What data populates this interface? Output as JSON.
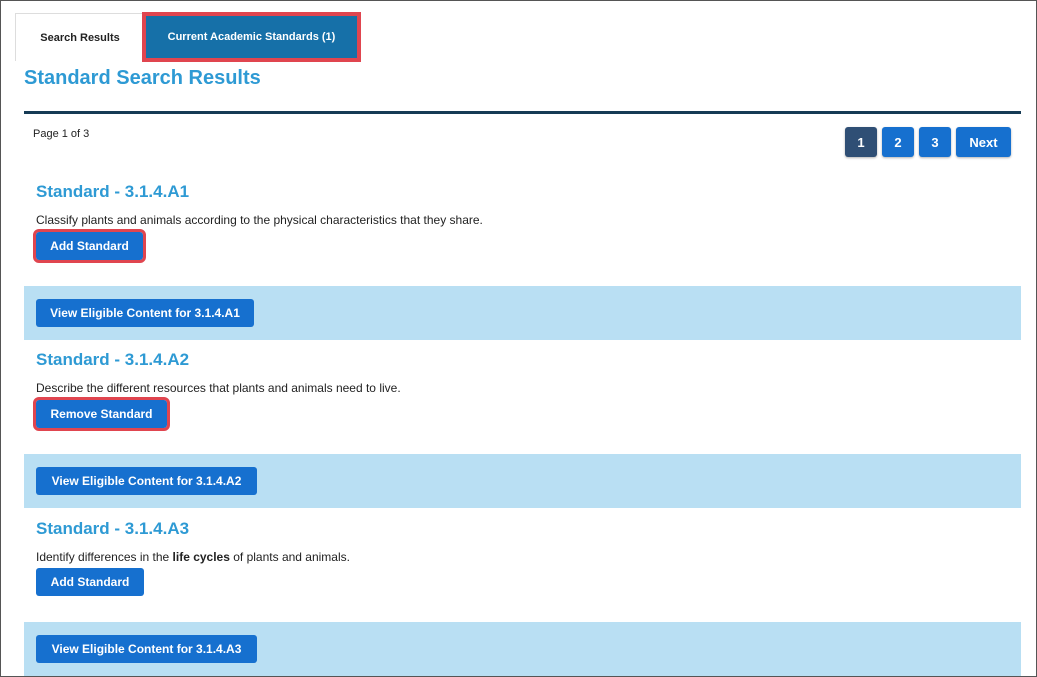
{
  "tabs": [
    {
      "label": "Search Results"
    },
    {
      "label": "Current Academic Standards (1)"
    }
  ],
  "title": "Standard Search Results",
  "page_info": "Page 1 of 3",
  "pagination": {
    "pages": [
      "1",
      "2",
      "3"
    ],
    "next": "Next",
    "current": "1"
  },
  "standards": [
    {
      "title": "Standard - 3.1.4.A1",
      "description": "Classify plants and animals according to the physical characteristics that they share.",
      "action": "Add Standard",
      "eligible": "View Eligible Content for 3.1.4.A1"
    },
    {
      "title": "Standard - 3.1.4.A2",
      "description": "Describe the different resources that plants and animals need to live.",
      "action": "Remove Standard",
      "eligible": "View Eligible Content for 3.1.4.A2"
    },
    {
      "title": "Standard - 3.1.4.A3",
      "description_pre": "Identify differences in the ",
      "description_bold": "life cycles",
      "description_post": " of plants and animals.",
      "action": "Add Standard",
      "eligible": "View Eligible Content for 3.1.4.A3"
    }
  ],
  "colors": {
    "accent": "#2e9ad4",
    "button": "#1670cf",
    "band": "#b9dff3",
    "highlight": "#e0454f",
    "rule": "#163b55"
  }
}
